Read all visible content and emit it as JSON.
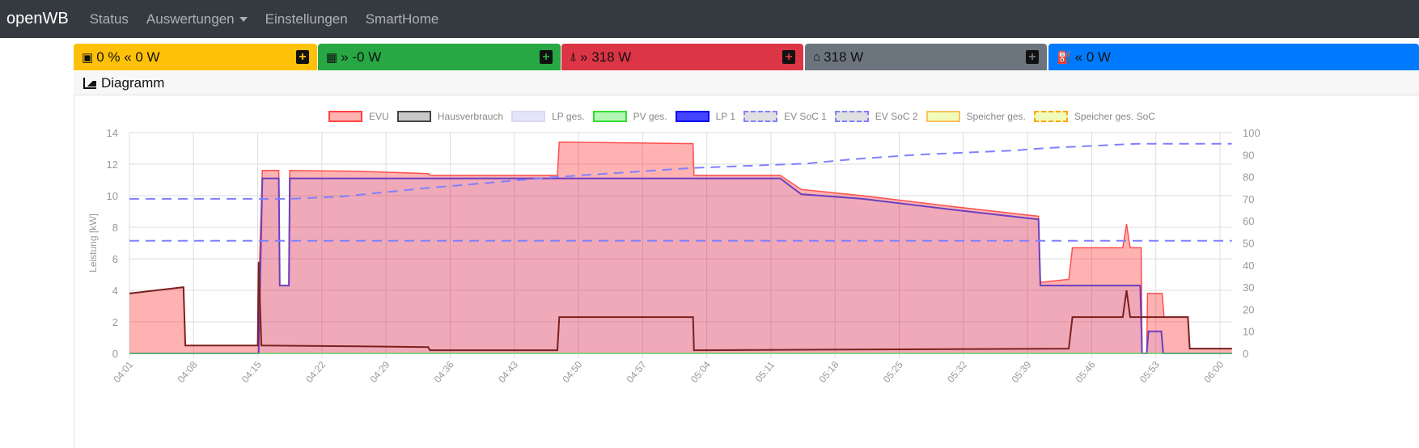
{
  "nav": {
    "brand": "openWB",
    "items": [
      "Status",
      "Auswertungen",
      "Einstellungen",
      "SmartHome"
    ]
  },
  "cards": [
    {
      "icon": "battery-icon",
      "glyph": "▣",
      "text": "0 % « 0 W",
      "color": "#ffc107",
      "plus_color": "#ffc107"
    },
    {
      "icon": "solar-panel-icon",
      "glyph": "▦",
      "text": "» -0 W",
      "color": "#28a745",
      "plus_color": "#28a745"
    },
    {
      "icon": "power-pylon-icon",
      "glyph": "⍋",
      "text": "» 318 W",
      "color": "#dc3545",
      "plus_color": "#dc3545"
    },
    {
      "icon": "house-icon",
      "glyph": "⌂",
      "text": "318 W",
      "color": "#6c757d",
      "plus_color": "#6c757d"
    },
    {
      "icon": "charging-station-icon",
      "glyph": "⛽",
      "text": "« 0 W",
      "color": "#007bff",
      "plus_color": "#007bff"
    }
  ],
  "diagram_title": "Diagramm",
  "chart_data": {
    "type": "line",
    "ylabel": "Leistung [kW]",
    "ylim": [
      0,
      14
    ],
    "y2lim": [
      0,
      100
    ],
    "yticks": [
      0,
      2,
      4,
      6,
      8,
      10,
      12,
      14
    ],
    "y2ticks": [
      0,
      10,
      20,
      30,
      40,
      50,
      60,
      70,
      80,
      90,
      100
    ],
    "xticks": [
      "04:01",
      "04:08",
      "04:15",
      "04:22",
      "04:29",
      "04:36",
      "04:43",
      "04:50",
      "04:57",
      "05:04",
      "05:11",
      "05:18",
      "05:25",
      "05:32",
      "05:39",
      "05:46",
      "05:53",
      "06:00"
    ],
    "x_unit": "minutes since 04:01",
    "legend": [
      {
        "name": "EVU",
        "fill": "rgba(255,0,0,0.3)",
        "stroke": "#ff4040",
        "dash": false
      },
      {
        "name": "Hausverbrauch",
        "fill": "#c8c8c8",
        "stroke": "#444",
        "dash": false
      },
      {
        "name": "LP ges.",
        "fill": "#e4e4fa",
        "stroke": "#d8d8f5",
        "dash": false
      },
      {
        "name": "PV ges.",
        "fill": "#b4f7b4",
        "stroke": "#33dd33",
        "dash": false
      },
      {
        "name": "LP 1",
        "fill": "#4444ff",
        "stroke": "#0000ee",
        "dash": false
      },
      {
        "name": "EV SoC 1",
        "fill": "#e0e0e0",
        "stroke": "#8080ff",
        "dash": true
      },
      {
        "name": "EV SoC 2",
        "fill": "#e0e0e0",
        "stroke": "#8080ff",
        "dash": true
      },
      {
        "name": "Speicher ges.",
        "fill": "#f0fcb8",
        "stroke": "#ffc060",
        "dash": false
      },
      {
        "name": "Speicher ges. SoC",
        "fill": "#f0fcb8",
        "stroke": "#ffa500",
        "dash": true
      }
    ],
    "series": [
      {
        "name": "EVU",
        "axis": "left",
        "points": [
          [
            0,
            3.8
          ],
          [
            5.9,
            4.2
          ],
          [
            6.1,
            0.5
          ],
          [
            14.0,
            0.5
          ],
          [
            14.2,
            6
          ],
          [
            14.5,
            11.6
          ],
          [
            16.3,
            11.6
          ],
          [
            16.4,
            4.3
          ],
          [
            17.4,
            4.3
          ],
          [
            17.5,
            11.6
          ],
          [
            25,
            11.55
          ],
          [
            32.6,
            11.4
          ],
          [
            32.8,
            11.3
          ],
          [
            46.7,
            11.3
          ],
          [
            46.9,
            13.4
          ],
          [
            61.5,
            13.3
          ],
          [
            61.6,
            11.3
          ],
          [
            71,
            11.3
          ],
          [
            73.3,
            10.4
          ],
          [
            80,
            10.0
          ],
          [
            90,
            9.3
          ],
          [
            99.2,
            8.7
          ],
          [
            99.4,
            4.5
          ],
          [
            102.5,
            4.7
          ],
          [
            102.9,
            6.7
          ],
          [
            108.4,
            6.7
          ],
          [
            108.8,
            8.2
          ],
          [
            109.2,
            6.7
          ],
          [
            110.4,
            6.7
          ],
          [
            110.5,
            0
          ],
          [
            111,
            0
          ],
          [
            111.1,
            3.8
          ],
          [
            112.7,
            3.8
          ],
          [
            112.9,
            2.3
          ],
          [
            115.5,
            2.3
          ],
          [
            115.7,
            0.3
          ],
          [
            120.3,
            0.3
          ]
        ]
      },
      {
        "name": "LP 1",
        "axis": "left",
        "points": [
          [
            0,
            0
          ],
          [
            14.1,
            0
          ],
          [
            14.5,
            11.1
          ],
          [
            16.3,
            11.1
          ],
          [
            16.4,
            4.3
          ],
          [
            17.4,
            4.3
          ],
          [
            17.5,
            11.1
          ],
          [
            46,
            11.1
          ],
          [
            71,
            11.1
          ],
          [
            73.3,
            10.1
          ],
          [
            80,
            9.8
          ],
          [
            90,
            9.1
          ],
          [
            99.2,
            8.5
          ],
          [
            99.4,
            4.3
          ],
          [
            110.3,
            4.3
          ],
          [
            110.5,
            0
          ],
          [
            111,
            0
          ],
          [
            111.2,
            1.4
          ],
          [
            112.6,
            1.4
          ],
          [
            112.8,
            0
          ],
          [
            120.3,
            0
          ]
        ]
      },
      {
        "name": "Hausverbrauch",
        "axis": "left",
        "points": [
          [
            0,
            3.8
          ],
          [
            5.9,
            4.2
          ],
          [
            6.1,
            0.5
          ],
          [
            14.0,
            0.5
          ],
          [
            14.1,
            5.8
          ],
          [
            14.4,
            0.5
          ],
          [
            25,
            0.45
          ],
          [
            32.6,
            0.4
          ],
          [
            32.8,
            0.2
          ],
          [
            46.7,
            0.2
          ],
          [
            46.9,
            2.3
          ],
          [
            61.5,
            2.3
          ],
          [
            61.6,
            0.2
          ],
          [
            102.5,
            0.3
          ],
          [
            102.9,
            2.3
          ],
          [
            108.4,
            2.3
          ],
          [
            108.8,
            4.0
          ],
          [
            109.2,
            2.3
          ],
          [
            115.5,
            2.3
          ],
          [
            115.7,
            0.3
          ],
          [
            120.3,
            0.3
          ]
        ]
      },
      {
        "name": "PV ges.",
        "axis": "left",
        "points": [
          [
            0,
            0
          ],
          [
            120.3,
            0
          ]
        ]
      },
      {
        "name": "EV SoC 1",
        "axis": "right",
        "points": [
          [
            0,
            70
          ],
          [
            17.5,
            70
          ],
          [
            23,
            71
          ],
          [
            32.7,
            75
          ],
          [
            46.9,
            80
          ],
          [
            61.5,
            84
          ],
          [
            74,
            86
          ],
          [
            79,
            88
          ],
          [
            86,
            90
          ],
          [
            97,
            92
          ],
          [
            100,
            93
          ],
          [
            110,
            95
          ],
          [
            120.3,
            95
          ]
        ]
      },
      {
        "name": "EV SoC 2",
        "axis": "right",
        "points": [
          [
            0,
            51
          ],
          [
            120.3,
            51
          ]
        ]
      }
    ]
  }
}
